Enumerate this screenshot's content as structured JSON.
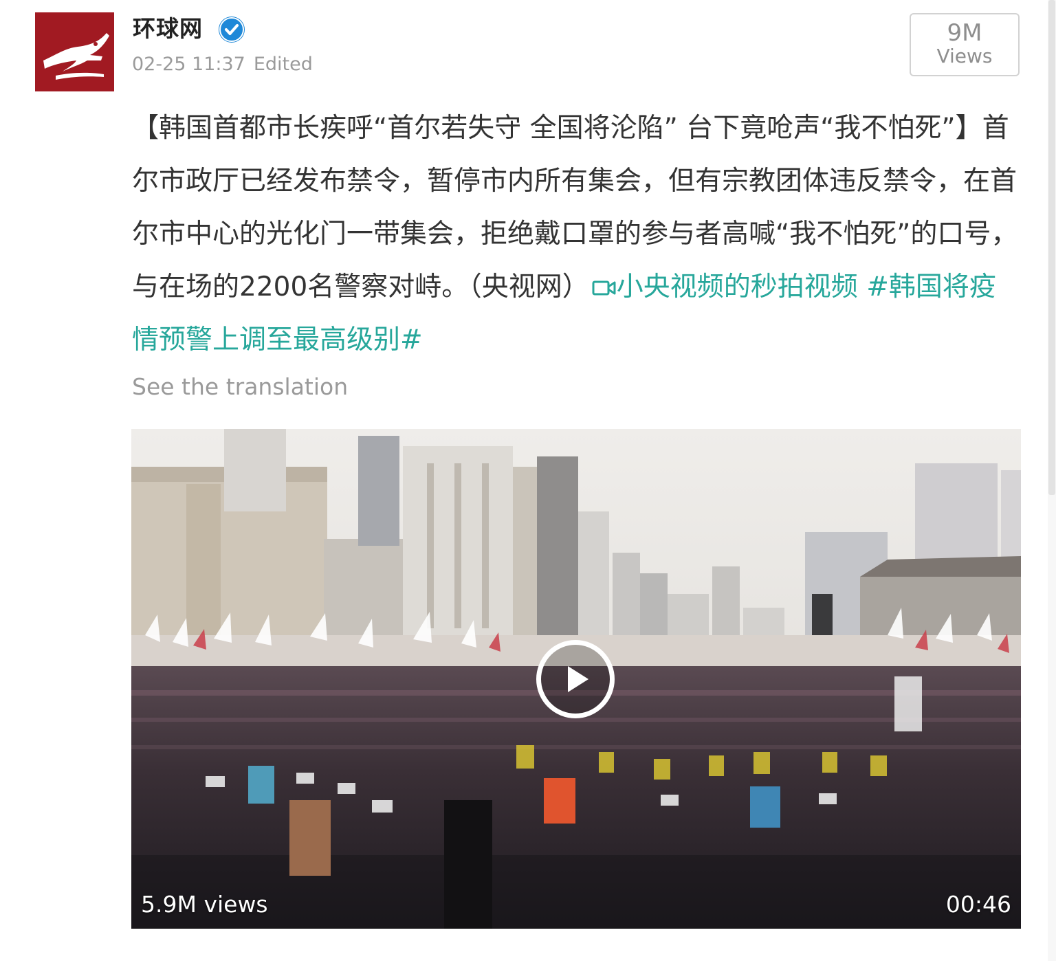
{
  "post": {
    "author": "环球网",
    "timestamp": "02-25 11:37",
    "edited_label": "Edited",
    "views_count": "9M",
    "views_label": "Views",
    "text": "【韩国首都市长疾呼“首尔若失守 全国将沦陷” 台下竟呛声“我不怕死”】首尔市政厅已经发布禁令，暂停市内所有集会，但有宗教团体违反禁令，在首尔市中心的光化门一带集会，拒绝戴口罩的参与者高喊“我不怕死”的口号，与在场的2200名警察对峙。（央视网）",
    "video_link": "小央视频的秒拍视频",
    "hashtag": "#韩国将疫情预警上调至最高级别#",
    "translate_label": "See the translation"
  },
  "video": {
    "views": "5.9M views",
    "duration": "00:46"
  },
  "colors": {
    "link": "#27a79b",
    "avatar_bg": "#a11a22",
    "verified": "#1e88d8",
    "meta_text": "#9a9a9a"
  },
  "icons": {
    "verified": "verified-badge-icon",
    "video_link": "video-camera-icon",
    "play": "play-icon"
  }
}
